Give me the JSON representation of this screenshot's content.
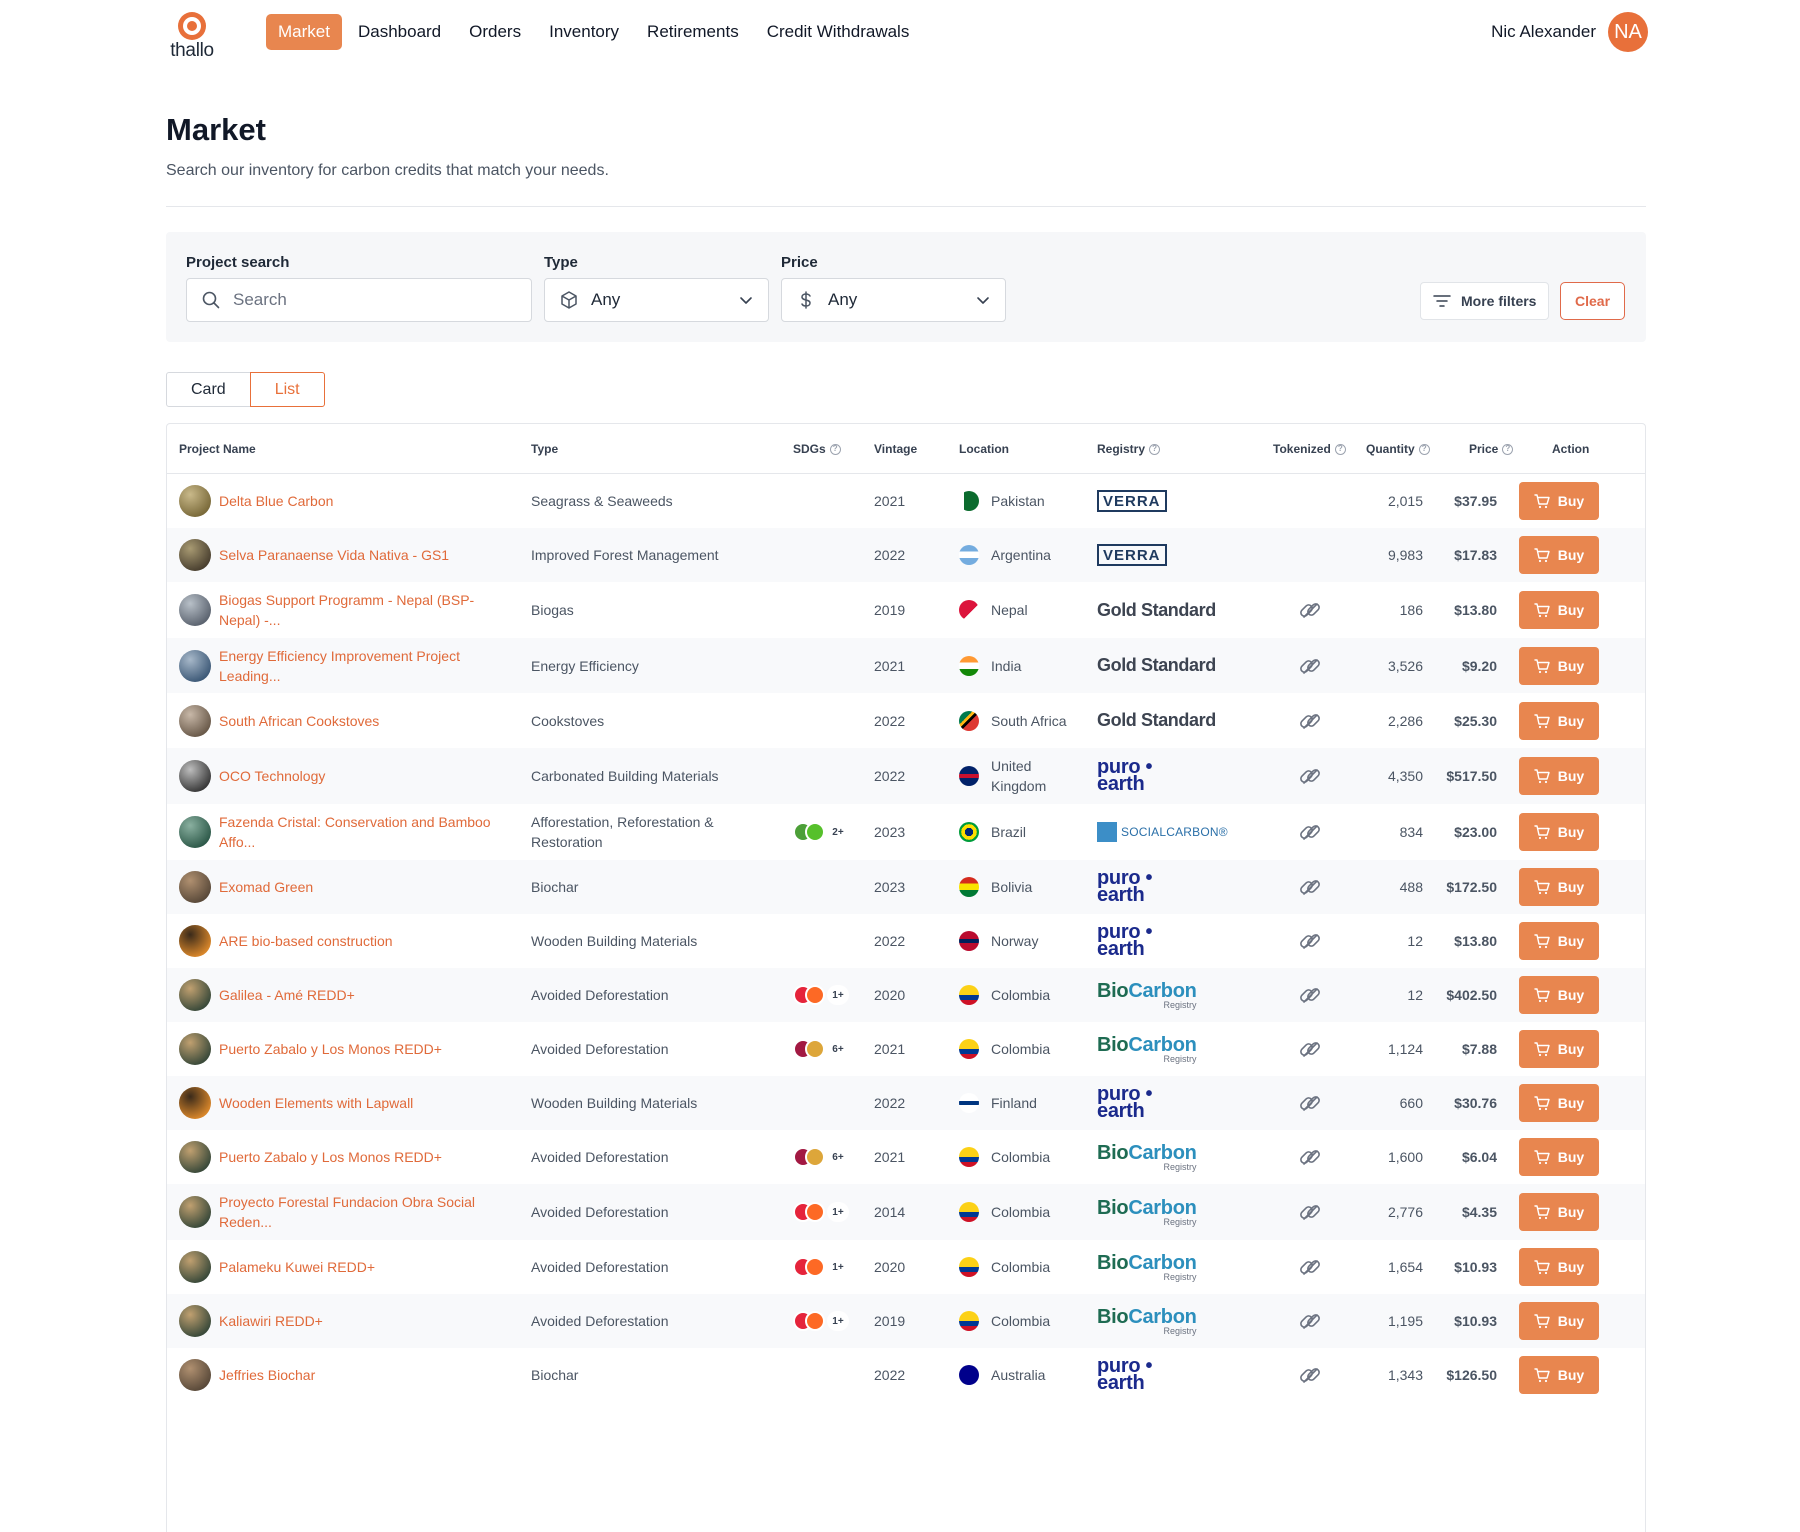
{
  "brand": {
    "name": "thallo",
    "accent": "#e8703a"
  },
  "nav": {
    "items": [
      {
        "label": "Market",
        "active": true
      },
      {
        "label": "Dashboard",
        "active": false
      },
      {
        "label": "Orders",
        "active": false
      },
      {
        "label": "Inventory",
        "active": false
      },
      {
        "label": "Retirements",
        "active": false
      },
      {
        "label": "Credit Withdrawals",
        "active": false
      }
    ]
  },
  "user": {
    "name": "Nic Alexander",
    "initials": "NA"
  },
  "header": {
    "title": "Market",
    "subtitle": "Search our inventory for carbon credits that match your needs."
  },
  "filters": {
    "search_label": "Project search",
    "search_placeholder": "Search",
    "type_label": "Type",
    "type_value": "Any",
    "price_label": "Price",
    "price_value": "Any",
    "more_filters": "More filters",
    "clear": "Clear"
  },
  "view_toggle": {
    "card": "Card",
    "list": "List",
    "selected": "List"
  },
  "table": {
    "columns": {
      "project": "Project Name",
      "type": "Type",
      "sdgs": "SDGs",
      "vintage": "Vintage",
      "location": "Location",
      "registry": "Registry",
      "tokenized": "Tokenized",
      "quantity": "Quantity",
      "price": "Price",
      "action": "Action"
    },
    "buy_label": "Buy",
    "rows": [
      {
        "name": "Delta Blue Carbon",
        "type": "Seagrass & Seaweeds",
        "sdg_more": "",
        "vintage": "2021",
        "location": "Pakistan",
        "registry": "VERRA",
        "tokenized": false,
        "quantity": "2,015",
        "price": "$37.95"
      },
      {
        "name": "Selva Paranaense Vida Nativa - GS1",
        "type": "Improved Forest Management",
        "sdg_more": "",
        "vintage": "2022",
        "location": "Argentina",
        "registry": "VERRA",
        "tokenized": false,
        "quantity": "9,983",
        "price": "$17.83"
      },
      {
        "name": "Biogas Support Programm - Nepal (BSP-Nepal) -...",
        "type": "Biogas",
        "sdg_more": "",
        "vintage": "2019",
        "location": "Nepal",
        "registry": "Gold Standard",
        "tokenized": true,
        "quantity": "186",
        "price": "$13.80"
      },
      {
        "name": "Energy Efficiency Improvement Project Leading...",
        "type": "Energy Efficiency",
        "sdg_more": "",
        "vintage": "2021",
        "location": "India",
        "registry": "Gold Standard",
        "tokenized": true,
        "quantity": "3,526",
        "price": "$9.20"
      },
      {
        "name": "South African Cookstoves",
        "type": "Cookstoves",
        "sdg_more": "",
        "vintage": "2022",
        "location": "South Africa",
        "registry": "Gold Standard",
        "tokenized": true,
        "quantity": "2,286",
        "price": "$25.30"
      },
      {
        "name": "OCO Technology",
        "type": "Carbonated Building Materials",
        "sdg_more": "",
        "vintage": "2022",
        "location": "United Kingdom",
        "registry": "puro earth",
        "tokenized": true,
        "quantity": "4,350",
        "price": "$517.50"
      },
      {
        "name": "Fazenda Cristal: Conservation and Bamboo Affo...",
        "type": "Afforestation, Reforestation & Restoration",
        "sdg_more": "2+",
        "vintage": "2023",
        "location": "Brazil",
        "registry": "SOCIALCARBON",
        "tokenized": true,
        "quantity": "834",
        "price": "$23.00"
      },
      {
        "name": "Exomad Green",
        "type": "Biochar",
        "sdg_more": "",
        "vintage": "2023",
        "location": "Bolivia",
        "registry": "puro earth",
        "tokenized": true,
        "quantity": "488",
        "price": "$172.50"
      },
      {
        "name": "ARE bio-based construction",
        "type": "Wooden Building Materials",
        "sdg_more": "",
        "vintage": "2022",
        "location": "Norway",
        "registry": "puro earth",
        "tokenized": true,
        "quantity": "12",
        "price": "$13.80"
      },
      {
        "name": "Galilea - Amé REDD+",
        "type": "Avoided Deforestation",
        "sdg_more": "1+",
        "vintage": "2020",
        "location": "Colombia",
        "registry": "BioCarbon",
        "tokenized": true,
        "quantity": "12",
        "price": "$402.50"
      },
      {
        "name": "Puerto Zabalo y Los Monos REDD+",
        "type": "Avoided Deforestation",
        "sdg_more": "6+",
        "vintage": "2021",
        "location": "Colombia",
        "registry": "BioCarbon",
        "tokenized": true,
        "quantity": "1,124",
        "price": "$7.88"
      },
      {
        "name": "Wooden Elements with Lapwall",
        "type": "Wooden Building Materials",
        "sdg_more": "",
        "vintage": "2022",
        "location": "Finland",
        "registry": "puro earth",
        "tokenized": true,
        "quantity": "660",
        "price": "$30.76"
      },
      {
        "name": "Puerto Zabalo y Los Monos REDD+",
        "type": "Avoided Deforestation",
        "sdg_more": "6+",
        "vintage": "2021",
        "location": "Colombia",
        "registry": "BioCarbon",
        "tokenized": true,
        "quantity": "1,600",
        "price": "$6.04"
      },
      {
        "name": "Proyecto Forestal Fundacion Obra Social Reden...",
        "type": "Avoided Deforestation",
        "sdg_more": "1+",
        "vintage": "2014",
        "location": "Colombia",
        "registry": "BioCarbon",
        "tokenized": true,
        "quantity": "2,776",
        "price": "$4.35"
      },
      {
        "name": "Palameku Kuwei REDD+",
        "type": "Avoided Deforestation",
        "sdg_more": "1+",
        "vintage": "2020",
        "location": "Colombia",
        "registry": "BioCarbon",
        "tokenized": true,
        "quantity": "1,654",
        "price": "$10.93"
      },
      {
        "name": "Kaliawiri REDD+",
        "type": "Avoided Deforestation",
        "sdg_more": "1+",
        "vintage": "2019",
        "location": "Colombia",
        "registry": "BioCarbon",
        "tokenized": true,
        "quantity": "1,195",
        "price": "$10.93"
      },
      {
        "name": "Jeffries Biochar",
        "type": "Biochar",
        "sdg_more": "",
        "vintage": "2022",
        "location": "Australia",
        "registry": "puro earth",
        "tokenized": true,
        "quantity": "1,343",
        "price": "$126.50"
      }
    ]
  },
  "registry_text": {
    "verra": "VERRA",
    "gold": "Gold Standard",
    "puro": "puro •\nearth",
    "social": "SOCIALCARBON®",
    "bio_a": "Bio",
    "bio_b": "Carbon",
    "bio_c": "Registry"
  }
}
